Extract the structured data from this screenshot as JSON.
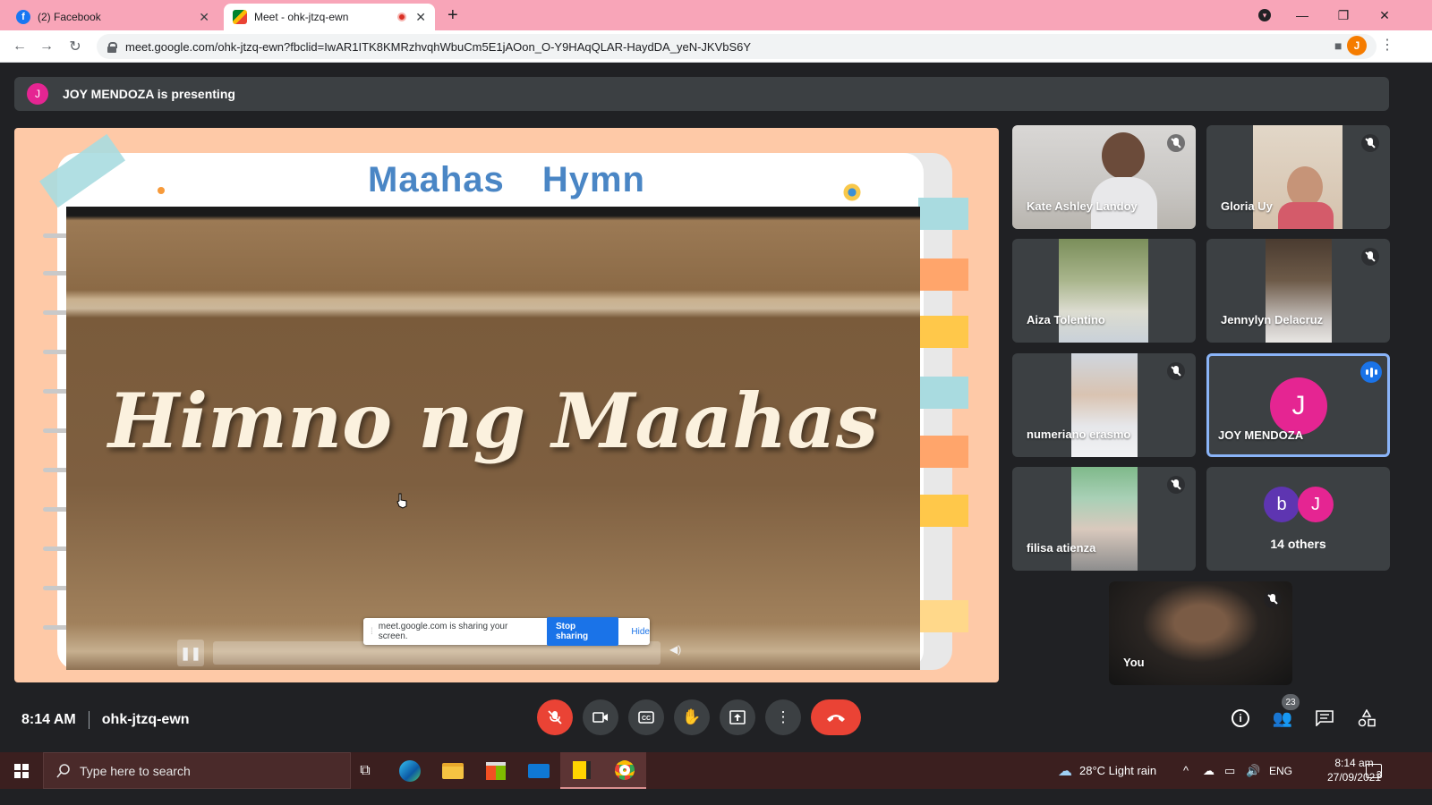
{
  "browser": {
    "tabs": [
      {
        "label": "(2) Facebook",
        "icon": "facebook-icon"
      },
      {
        "label": "Meet - ohk-jtzq-ewn",
        "icon": "google-meet-icon",
        "recording": true
      }
    ],
    "url": "meet.google.com/ohk-jtzq-ewn?fbclid=IwAR1ITK8KMRzhvqhWbuCm5E1jAOon_O-Y9HAqQLAR-HaydDA_yeN-JKVbS6Y",
    "profile_initial": "J"
  },
  "meet": {
    "presenter_initial": "J",
    "presenting_banner": "JOY MENDOZA is presenting",
    "slide": {
      "title": "Maahas Hymn",
      "video_text": "Himno ng Maahas"
    },
    "share_bar": {
      "message": "meet.google.com is sharing your screen.",
      "stop_label": "Stop sharing",
      "hide_label": "Hide"
    },
    "participants": [
      {
        "name": "Kate Ashley Landoy",
        "muted": true
      },
      {
        "name": "Gloria Uy",
        "muted": true
      },
      {
        "name": "Aiza Tolentino",
        "muted": false
      },
      {
        "name": "Jennylyn Delacruz",
        "muted": true
      },
      {
        "name": "numeriano erasmo",
        "muted": true
      },
      {
        "name": "JOY MENDOZA",
        "initial": "J",
        "speaking": true
      },
      {
        "name": "filisa atienza",
        "muted": true
      }
    ],
    "others": {
      "label": "14 others",
      "initials": [
        "b",
        "J"
      ]
    },
    "self_label": "You",
    "time": "8:14 AM",
    "meeting_code": "ohk-jtzq-ewn",
    "participant_count": "23"
  },
  "taskbar": {
    "search_placeholder": "Type here to search",
    "weather": "28°C  Light rain",
    "language": "ENG",
    "time": "8:14 am",
    "date": "27/09/2021",
    "notifications": "3"
  },
  "colors": {
    "tab_strip": "#f8a5b8",
    "meet_bg": "#202124",
    "tile_bg": "#3c4043",
    "end_call": "#ea4335",
    "accent_blue": "#1a73e8",
    "avatar_pink": "#e52592"
  }
}
